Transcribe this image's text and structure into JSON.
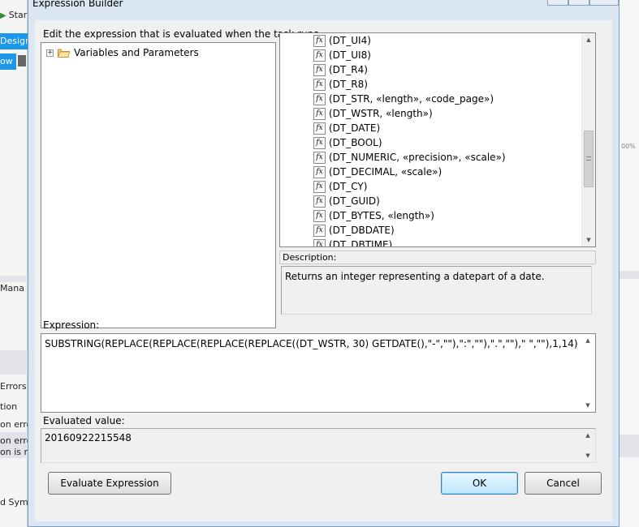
{
  "background": {
    "start_label": "Star",
    "design_tab": "Design",
    "ow_label": "ow",
    "mana_label": "Mana",
    "errors_label": "Errors",
    "tion_label": "tion",
    "on_err1": "on erro",
    "on_err2": "on erro",
    "on_is": "on is n",
    "d_sym": "d Sym",
    "right_pct": "00%"
  },
  "dialog": {
    "title": "Expression Builder",
    "instruction": "Edit the expression that is evaluated when the task runs.",
    "tree": {
      "root_label": "Variables and Parameters"
    },
    "functions": [
      "(DT_UI4)",
      "(DT_UI8)",
      "(DT_R4)",
      "(DT_R8)",
      "(DT_STR, «length», «code_page»)",
      "(DT_WSTR, «length»)",
      "(DT_DATE)",
      "(DT_BOOL)",
      "(DT_NUMERIC, «precision», «scale»)",
      "(DT_DECIMAL, «scale»)",
      "(DT_CY)",
      "(DT_GUID)",
      "(DT_BYTES, «length»)",
      "(DT_DBDATE)",
      "(DT_DBTIME)"
    ],
    "description_label": "Description:",
    "description_text": "Returns an integer representing a datepart of a date.",
    "expression_label": "Expression:",
    "expression_value": "SUBSTRING(REPLACE(REPLACE(REPLACE(REPLACE((DT_WSTR, 30) GETDATE(),\"-\",\"\"),\":\",\"\"),\".\",\"\"),\" \",\"\"),1,14)",
    "evaluated_label": "Evaluated value:",
    "evaluated_value": "20160922215548",
    "buttons": {
      "evaluate": "Evaluate Expression",
      "ok": "OK",
      "cancel": "Cancel"
    }
  }
}
